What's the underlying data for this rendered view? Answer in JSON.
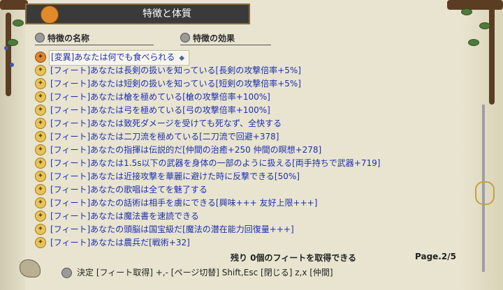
{
  "title": "特徴と体質",
  "columns": {
    "name": "特徴の名称",
    "effect": "特徴の効果"
  },
  "rows": [
    {
      "icon": "mutation-icon",
      "text": "[変異]あなたは何でも食べられる",
      "selected": true
    },
    {
      "icon": "feat-icon",
      "text": "[フィート]あなたは長剣の扱いを知っている[長剣の攻撃倍率+5%]"
    },
    {
      "icon": "feat-icon",
      "text": "[フィート]あなたは短剣の扱いを知っている[短剣の攻撃倍率+5%]"
    },
    {
      "icon": "feat-icon",
      "text": "[フィート]あなたは槍を極めている[槍の攻撃倍率+100%]"
    },
    {
      "icon": "feat-icon",
      "text": "[フィート]あなたは弓を極めている[弓の攻撃倍率+100%]"
    },
    {
      "icon": "feat-icon",
      "text": "[フィート]あなたは致死ダメージを受けても死なず、全快する"
    },
    {
      "icon": "feat-icon",
      "text": "[フィート]あなたは二刀流を極めている[二刀流で回避+378]"
    },
    {
      "icon": "feat-icon",
      "text": "[フィート]あなたの指揮は伝説的だ[仲間の治癒+250 仲間の瞑想+278]"
    },
    {
      "icon": "feat-icon",
      "text": "[フィート]あなたは1.5s以下の武器を身体の一部のように扱える[両手持ちで武器+719]"
    },
    {
      "icon": "feat-icon",
      "text": "[フィート]あなたは近接攻撃を華麗に避けた時に反撃できる[50%]"
    },
    {
      "icon": "feat-icon",
      "text": "[フィート]あなたの歌唱は全てを魅了する"
    },
    {
      "icon": "feat-icon",
      "text": "[フィート]あなたの話術は相手を虜にできる[興味+++ 友好上限+++]"
    },
    {
      "icon": "feat-icon",
      "text": "[フィート]あなたは魔法書を速読できる"
    },
    {
      "icon": "feat-icon",
      "text": "[フィート]あなたの頭脳は国宝級だ[魔法の潜在能力回復量+++]"
    },
    {
      "icon": "feat-icon",
      "text": "[フィート]あなたは農兵だ[戦術+32]"
    }
  ],
  "remaining": "残り 0個のフィートを取得できる",
  "page": "Page.2/5",
  "help": "決定 [フィート取得]  +,- [ページ切替]  Shift,Esc [閉じる]  z,x [仲間]",
  "selected_arrow": "◆"
}
